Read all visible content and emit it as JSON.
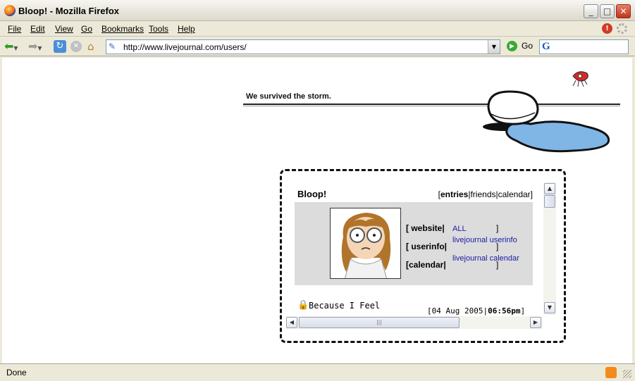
{
  "window": {
    "title": "Bloop! - Mozilla Firefox",
    "minimize": "_",
    "maximize": "□",
    "close": "✕"
  },
  "menu": {
    "file": "File",
    "edit": "Edit",
    "view": "View",
    "go": "Go",
    "bookmarks": "Bookmarks",
    "tools": "Tools",
    "help": "Help"
  },
  "navigation": {
    "url": "http://www.livejournal.com/users/",
    "go_label": "Go"
  },
  "page": {
    "header_text": "We survived the storm.",
    "journal": {
      "title": "Bloop!",
      "nav_open": "[",
      "nav_entries": "entries",
      "nav_sep1": "|",
      "nav_friends": "friends",
      "nav_sep2": "|",
      "nav_calendar": "calendar",
      "nav_close": "]",
      "links": [
        {
          "label": "[  website|",
          "value": "ALL",
          "close": "]"
        },
        {
          "label": "[ userinfo|",
          "value": "livejournal userinfo",
          "close": "]"
        },
        {
          "label": "[calendar|",
          "value": "livejournal calendar",
          "close": "]"
        }
      ],
      "entry": {
        "title": "Because I Feel",
        "date": "[04 Aug 2005|",
        "time": "06:56pm",
        "time_close": "]"
      }
    }
  },
  "status": {
    "text": "Done"
  },
  "colors": {
    "link": "#1a1aa6",
    "panel": "#dcdcdc",
    "puddle": "#7fb6e6"
  }
}
